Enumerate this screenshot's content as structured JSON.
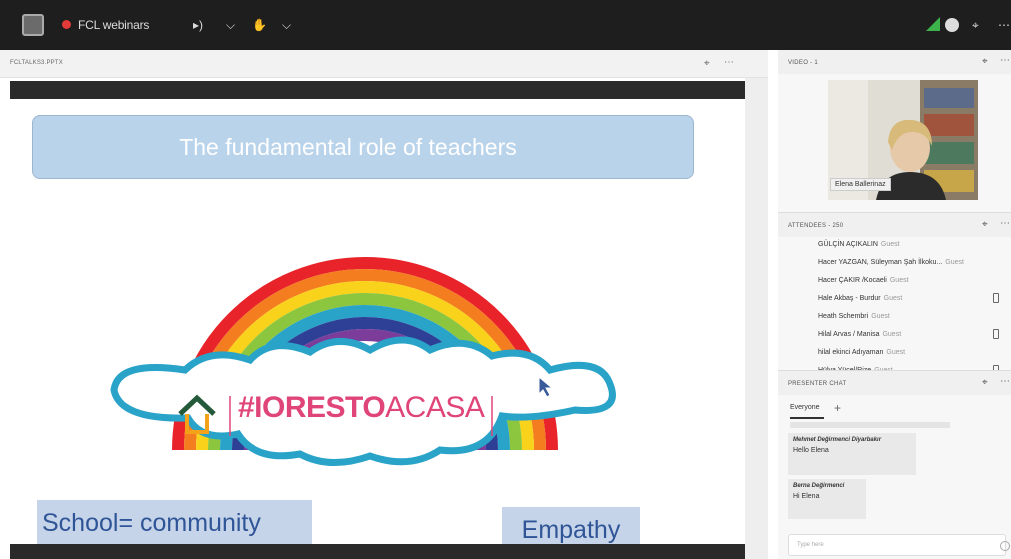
{
  "app": {
    "meeting_title": "FCL webinars"
  },
  "topbar": {
    "icons": [
      "layout-grid-icon",
      "record-dot-icon",
      "speaker-icon",
      "chevron-down-icon",
      "raise-hand-icon",
      "chevron-down-icon",
      "signal-icon",
      "help-icon",
      "fullscreen-icon",
      "more-icon"
    ],
    "colors": {
      "bar": "#1e1e1e",
      "record": "#e53a3a",
      "audio": "#3cb44b"
    }
  },
  "share_pod": {
    "title": "FCLTALKS3.PPTX"
  },
  "slide": {
    "title": "The fundamental  role of teachers",
    "hashtag_bold": "#IORESTO",
    "hashtag_light": "ACASA",
    "box_left": "School= community",
    "box_right": "Empathy",
    "colors": {
      "title_box": "#b9d3ea",
      "text_boxes": "#c6d4ea",
      "hashtag": "#e0457a",
      "cloud": "#29a3c8"
    }
  },
  "video_pod": {
    "title": "VIDEO - 1",
    "name_label": "Elena Ballerinaz"
  },
  "attendees_pod": {
    "title": "ATTENDEES - 250",
    "rows": [
      {
        "name": "GÜLÇİN AÇIKALIN",
        "role": "Guest",
        "phone": false
      },
      {
        "name": "Hacer YAZGAN, Süleyman Şah İlkoku...",
        "role": "Guest",
        "phone": false
      },
      {
        "name": "Hacer ÇAKIR /Kocaeli",
        "role": "Guest",
        "phone": false
      },
      {
        "name": "Hale Akbaş - Burdur",
        "role": "Guest",
        "phone": true
      },
      {
        "name": "Heath Schembri",
        "role": "Guest",
        "phone": false
      },
      {
        "name": "Hilal Arvas / Manisa",
        "role": "Guest",
        "phone": true
      },
      {
        "name": "hilal ekinci Adıyaman",
        "role": "Guest",
        "phone": false
      },
      {
        "name": "Hülya Yücel/Rize",
        "role": "Guest",
        "phone": true
      }
    ]
  },
  "chat_pod": {
    "title": "PRESENTER CHAT",
    "tab": "Everyone",
    "messages": [
      {
        "sender": "Mehmet Değirmenci Diyarbakır",
        "text": "Hello Elena"
      },
      {
        "sender": "Berna Değirmenci",
        "text": "Hi Elena"
      }
    ],
    "input_placeholder": "Type here"
  }
}
